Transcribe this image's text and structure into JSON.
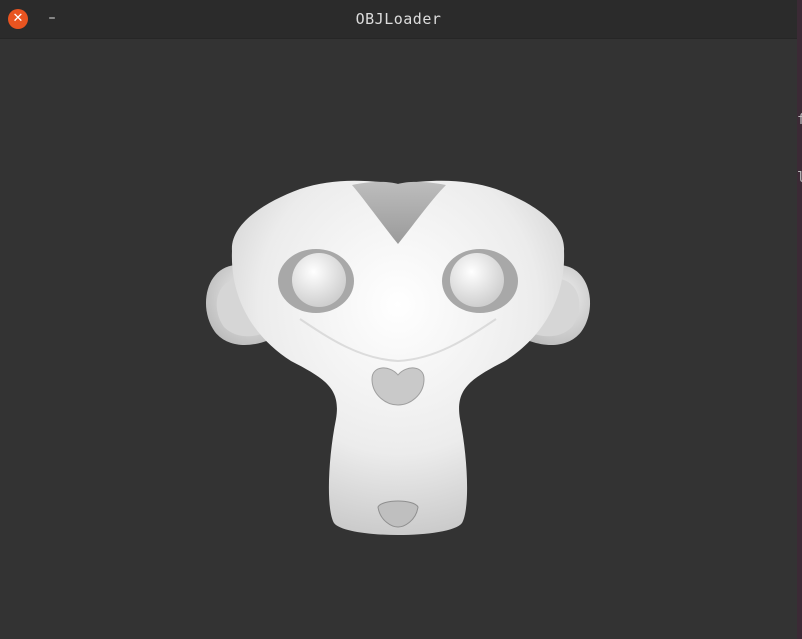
{
  "window": {
    "title": "OBJLoader",
    "close_glyph": "✕",
    "minimize_glyph": "–"
  },
  "viewport": {
    "background_color": "#333333",
    "model_color": "#e8e8e8",
    "model_name": "monkey-head-icon"
  },
  "background_window": {
    "char_1": "f",
    "char_2": "l"
  },
  "colors": {
    "close_button": "#e95420",
    "titlebar": "#2b2b2b"
  }
}
